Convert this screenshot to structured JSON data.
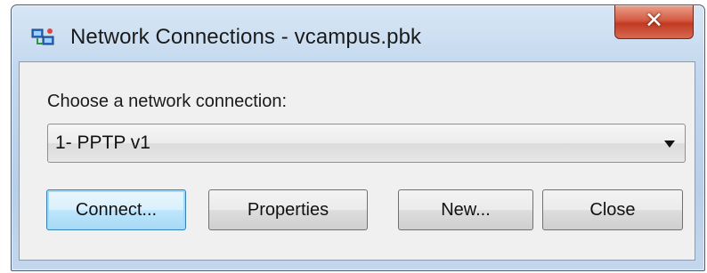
{
  "window": {
    "title": "Network Connections - vcampus.pbk",
    "close_glyph": "✕"
  },
  "dialog": {
    "choose_label": "Choose a network connection:",
    "connection_selected": "1- PPTP v1"
  },
  "buttons": {
    "connect": "Connect...",
    "properties": "Properties",
    "new": "New...",
    "close": "Close"
  },
  "icons": {
    "title_icon": "network-connections-icon",
    "dropdown_icon": "chevron-down-icon"
  },
  "colors": {
    "frame": "#c3d8ee",
    "close_button": "#c13a22",
    "default_button": "#bee6fd"
  }
}
